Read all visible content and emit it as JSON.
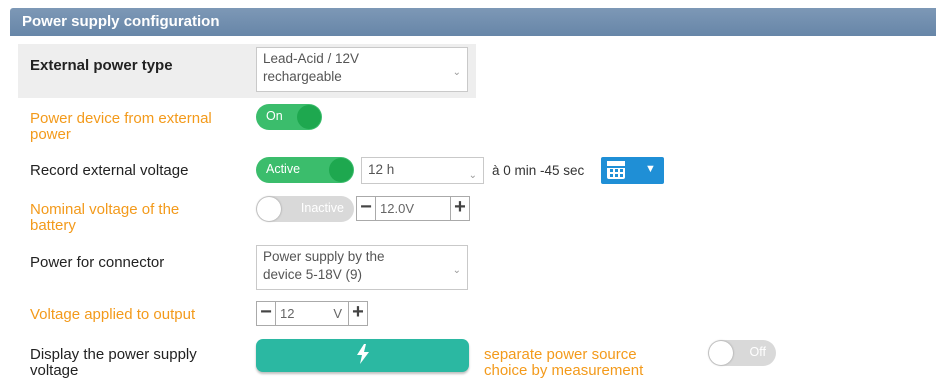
{
  "header": {
    "title": "Power supply configuration"
  },
  "rows": {
    "external_power_type": {
      "label": "External power type",
      "select_line1": "Lead-Acid / 12V",
      "select_line2": "rechargeable"
    },
    "power_from_external": {
      "label_line1": "Power device from external",
      "label_line2": "power",
      "toggle": "On"
    },
    "record_voltage": {
      "label": "Record external voltage",
      "toggle": "Active",
      "interval": "12 h",
      "offset": "à 0 min -45 sec"
    },
    "nominal_voltage": {
      "label_line1": "Nominal voltage of the",
      "label_line2": "battery",
      "toggle": "Inactive",
      "value": "12.0",
      "unit": "V"
    },
    "power_for_connector": {
      "label": "Power for connector",
      "select_line1": "Power supply by the",
      "select_line2": "device 5-18V (9)"
    },
    "voltage_output": {
      "label": "Voltage applied to output",
      "value": "12",
      "unit": "V"
    },
    "display_voltage": {
      "label_line1": "Display the power supply",
      "label_line2": "voltage",
      "button_icon": "lightning-icon",
      "separate_line1": "separate power source",
      "separate_line2": "choice by measurement",
      "toggle": "Off"
    }
  },
  "colors": {
    "header": "#6f8caf",
    "orange": "#f39a1b",
    "green": "#3bbd6c",
    "teal": "#2bb8a2",
    "blue": "#1f8fd6"
  }
}
